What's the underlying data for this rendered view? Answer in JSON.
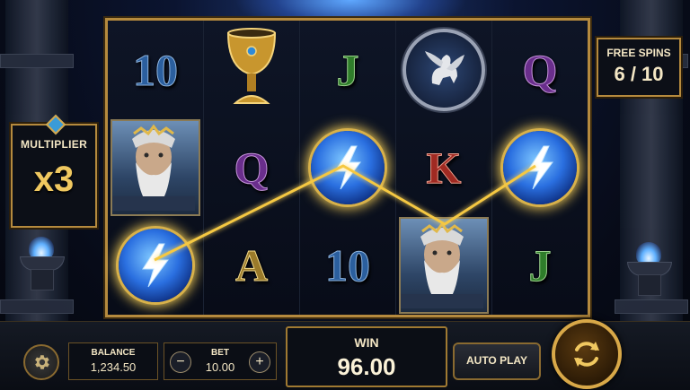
{
  "reels": [
    {
      "symbols": [
        {
          "type": "text",
          "label": "10",
          "cls": "c10"
        },
        {
          "type": "icon",
          "icon": "zeus-portrait-icon"
        },
        {
          "type": "icon",
          "icon": "lightning-orb-icon"
        }
      ]
    },
    {
      "symbols": [
        {
          "type": "icon",
          "icon": "golden-chalice-icon"
        },
        {
          "type": "text",
          "label": "Q",
          "cls": "cQ"
        },
        {
          "type": "text",
          "label": "A",
          "cls": "cA"
        }
      ]
    },
    {
      "symbols": [
        {
          "type": "text",
          "label": "J",
          "cls": "cJ"
        },
        {
          "type": "icon",
          "icon": "lightning-orb-icon"
        },
        {
          "type": "text",
          "label": "10",
          "cls": "c10"
        }
      ]
    },
    {
      "symbols": [
        {
          "type": "icon",
          "icon": "pegasus-medallion-icon"
        },
        {
          "type": "text",
          "label": "K",
          "cls": "cK"
        },
        {
          "type": "icon",
          "icon": "zeus-portrait-icon"
        }
      ]
    },
    {
      "symbols": [
        {
          "type": "text",
          "label": "Q",
          "cls": "cQ"
        },
        {
          "type": "icon",
          "icon": "lightning-orb-icon"
        },
        {
          "type": "text",
          "label": "J",
          "cls": "cJ"
        }
      ]
    }
  ],
  "multiplier": {
    "label": "MULTIPLIER",
    "value": "x3"
  },
  "free_spins": {
    "label": "FREE SPINS",
    "value": "6 / 10"
  },
  "controls": {
    "balance_label": "BALANCE",
    "balance_value": "1,234.50",
    "bet_label": "BET",
    "bet_value": "10.00",
    "bet_minus": "−",
    "bet_plus": "+",
    "win_label": "WIN",
    "win_value": "96.00",
    "autoplay_label": "AUTO PLAY"
  },
  "colors": {
    "frame_gold": "#b58a3e",
    "payline": "#f5c842",
    "orb_blue": "#2a6fe0"
  }
}
